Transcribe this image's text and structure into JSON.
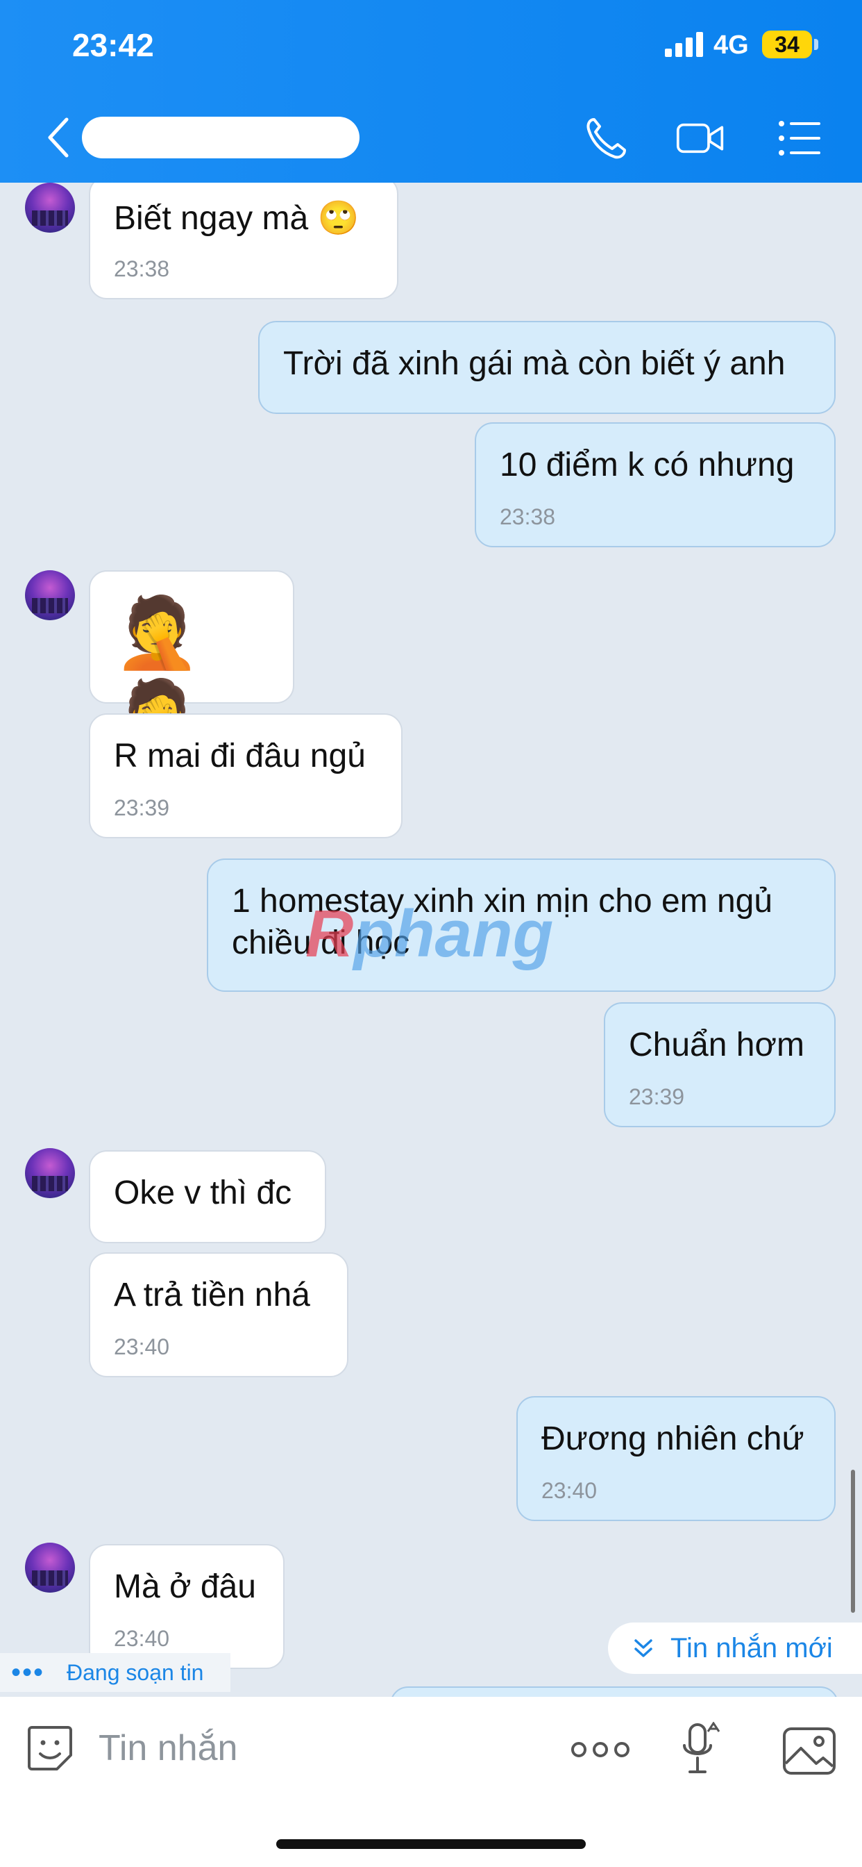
{
  "status": {
    "time": "23:42",
    "network": "4G",
    "battery": "34"
  },
  "header": {
    "contact_name": "Contact name (hidden)"
  },
  "messages": [
    {
      "side": "in",
      "text": "Biết ngay mà 🙄",
      "time": "23:38"
    },
    {
      "side": "out",
      "text": "Trời đã xinh gái mà còn biết ý anh"
    },
    {
      "side": "out",
      "text": "10 điểm k có nhưng",
      "time": "23:38"
    },
    {
      "side": "in",
      "text": "🤦🤦"
    },
    {
      "side": "in",
      "text": "R mai đi đâu ngủ",
      "time": "23:39"
    },
    {
      "side": "out",
      "text": "1 homestay xinh xin mịn cho em ngủ chiều đi học"
    },
    {
      "side": "out",
      "text": "Chuẩn hơm",
      "time": "23:39"
    },
    {
      "side": "in",
      "text": "Oke v thì đc"
    },
    {
      "side": "in",
      "text": "A trả tiền nhá",
      "time": "23:40"
    },
    {
      "side": "out",
      "text": "Đương nhiên chứ",
      "time": "23:40"
    },
    {
      "side": "in",
      "text": "Mà ở đâu",
      "time": "23:40"
    }
  ],
  "watermark": {
    "part1": "R",
    "part2": "phang"
  },
  "typing_indicator": "Đang soạn tin",
  "new_messages_button": "Tin nhắn mới",
  "composer": {
    "placeholder": "Tin nhắn"
  },
  "icons": {
    "back": "chevron-left-icon",
    "call": "phone-icon",
    "video": "video-camera-icon",
    "menu": "list-menu-icon",
    "sticker": "sticker-icon",
    "more": "more-dots-icon",
    "mic": "microphone-icon",
    "gallery": "image-icon"
  },
  "colors": {
    "header": "#1d8ff5",
    "outgoing_bubble": "#d6ecfb",
    "incoming_bubble": "#ffffff",
    "accent": "#1b86e6"
  }
}
